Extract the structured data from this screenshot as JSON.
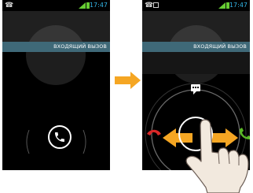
{
  "phones": [
    {
      "status": {
        "time": "17:47"
      },
      "incoming_label": "ВХОДЯЩИЙ ВЫЗОВ",
      "icons": [
        "phone-icon"
      ]
    },
    {
      "status": {
        "time": "17:47"
      },
      "incoming_label": "ВХОДЯЩИЙ ВЫЗОВ",
      "icons": [
        "phone-icon",
        "picture-icon",
        "message-icon",
        "decline-call-icon",
        "answer-call-icon"
      ]
    }
  ],
  "colors": {
    "accent_blue": "#33b5e5",
    "banner": "#3f6978",
    "arrow_orange": "#f5a623",
    "decline_red": "#d92727",
    "answer_green": "#5ab826"
  }
}
